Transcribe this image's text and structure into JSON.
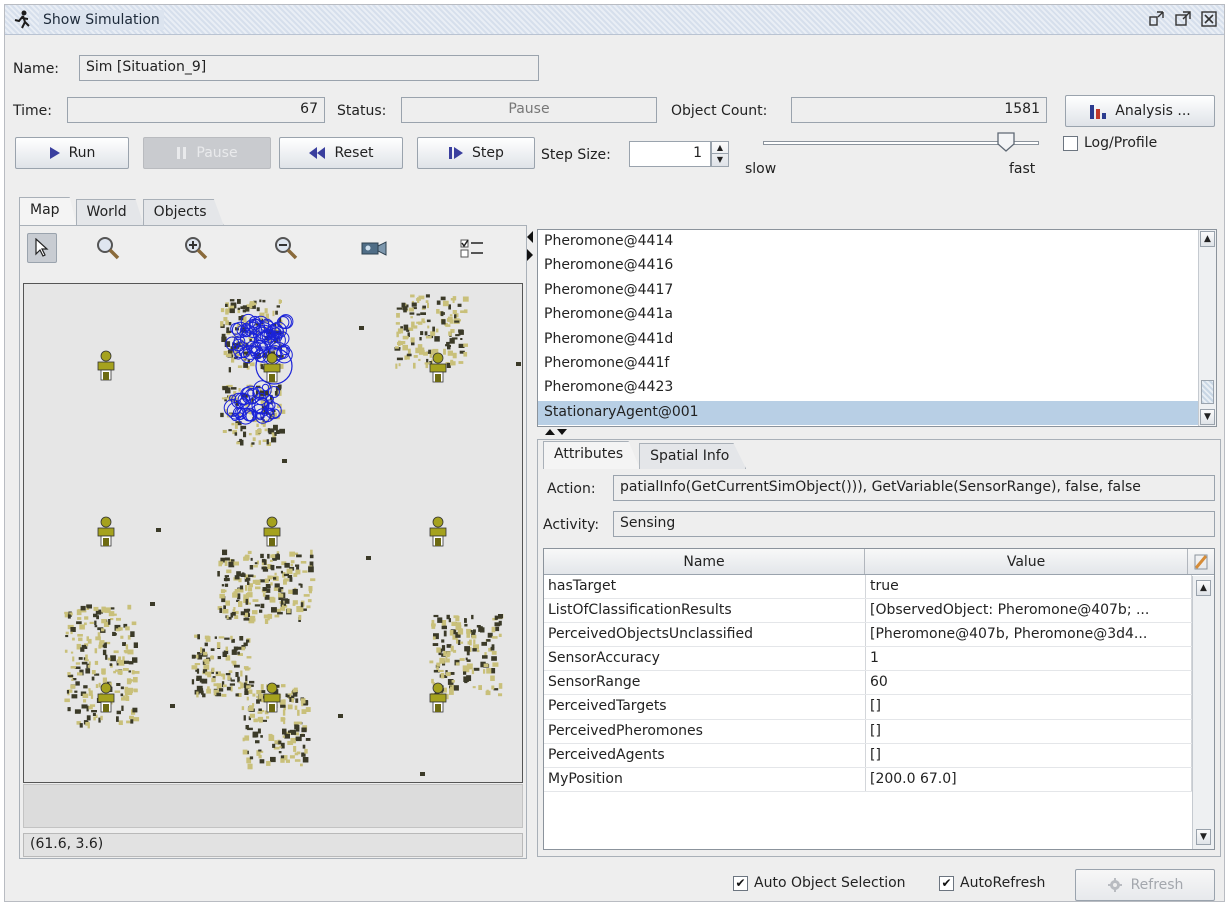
{
  "window": {
    "title": "Show Simulation",
    "icons": [
      "running-man-icon",
      "minimize-icon",
      "maximize-icon",
      "close-icon"
    ]
  },
  "name_row": {
    "label": "Name:",
    "value": "Sim [Situation_9]"
  },
  "status_row": {
    "time_label": "Time:",
    "time_value": "67",
    "status_label": "Status:",
    "status_value": "Pause",
    "object_count_label": "Object Count:",
    "object_count_value": "1581",
    "analysis_button": "Analysis ..."
  },
  "controls": {
    "run": "Run",
    "pause": "Pause",
    "reset": "Reset",
    "step": "Step",
    "step_size_label": "Step Size:",
    "step_size_value": "1",
    "slider_min_label": "slow",
    "slider_max_label": "fast",
    "speed_level": 0.88,
    "log_profile_label": "Log/Profile",
    "log_profile_checked": false
  },
  "view_tabs": [
    "Map",
    "World",
    "Objects"
  ],
  "map": {
    "tools": [
      "pointer-icon",
      "zoom-icon",
      "zoom-in-icon",
      "zoom-out-icon",
      "camera-icon",
      "layers-toggle-icon"
    ],
    "coordinates": "(61.6, 3.6)"
  },
  "object_list": {
    "items": [
      "Pheromone@4414",
      "Pheromone@4416",
      "Pheromone@4417",
      "Pheromone@441a",
      "Pheromone@441d",
      "Pheromone@441f",
      "Pheromone@4423",
      "StationaryAgent@001"
    ],
    "selected_index": 7
  },
  "detail_tabs": [
    "Attributes",
    "Spatial Info"
  ],
  "attributes": {
    "action_label": "Action:",
    "action_value": "patialInfo(GetCurrentSimObject())), GetVariable(SensorRange), false, false",
    "activity_label": "Activity:",
    "activity_value": "Sensing",
    "columns": [
      "Name",
      "Value"
    ],
    "rows": [
      [
        "hasTarget",
        "true"
      ],
      [
        "ListOfClassificationResults",
        "[ObservedObject: Pheromone@407b; ..."
      ],
      [
        "PerceivedObjectsUnclassified",
        "[Pheromone@407b, Pheromone@3d4..."
      ],
      [
        "SensorAccuracy",
        "1"
      ],
      [
        "SensorRange",
        "60"
      ],
      [
        "PerceivedTargets",
        "[]"
      ],
      [
        "PerceivedPheromones",
        "[]"
      ],
      [
        "PerceivedAgents",
        "[]"
      ],
      [
        "MyPosition",
        "[200.0 67.0]"
      ]
    ]
  },
  "footer": {
    "auto_object_selection": "Auto Object Selection",
    "auto_object_selection_checked": true,
    "auto_refresh": "AutoRefresh",
    "auto_refresh_checked": true,
    "refresh": "Refresh"
  },
  "colors": {
    "selection": "#b8cfe5",
    "pheromone": "#1a22d8",
    "cluster": "#c9c07a",
    "agent": "#a5a21e"
  }
}
